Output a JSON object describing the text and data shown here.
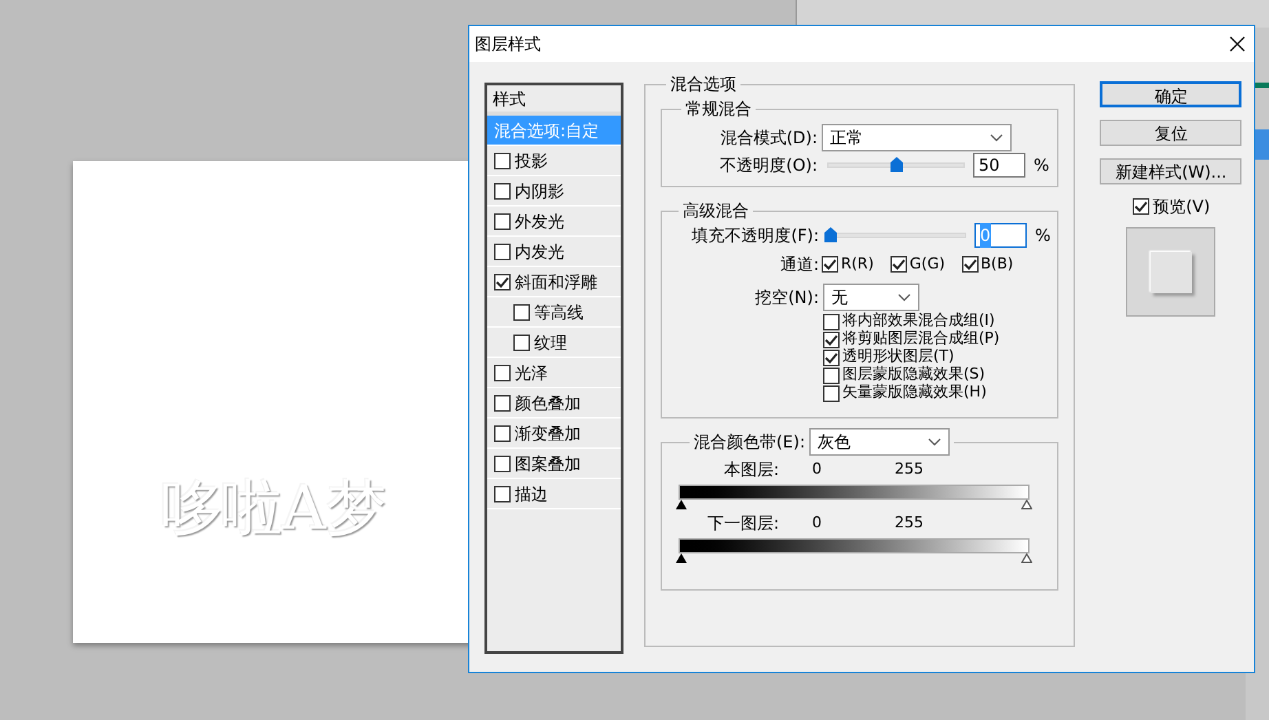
{
  "canvas": {
    "text": "哆啦A梦"
  },
  "window": {
    "title": "图层样式"
  },
  "styles": {
    "header": "样式",
    "items": [
      {
        "label": "混合选项:自定",
        "kind": "plain",
        "selected": true
      },
      {
        "label": "投影",
        "kind": "checkbox",
        "selected": false,
        "checked": false
      },
      {
        "label": "内阴影",
        "kind": "checkbox",
        "selected": false,
        "checked": false
      },
      {
        "label": "外发光",
        "kind": "checkbox",
        "selected": false,
        "checked": false
      },
      {
        "label": "内发光",
        "kind": "checkbox",
        "selected": false,
        "checked": false
      },
      {
        "label": "斜面和浮雕",
        "kind": "checkbox",
        "selected": false,
        "checked": true,
        "children": [
          {
            "label": "等高线",
            "kind": "checkbox",
            "selected": false,
            "checked": false
          },
          {
            "label": "纹理",
            "kind": "checkbox",
            "selected": false,
            "checked": false
          }
        ]
      },
      {
        "label": "光泽",
        "kind": "checkbox",
        "selected": false,
        "checked": false
      },
      {
        "label": "颜色叠加",
        "kind": "checkbox",
        "selected": false,
        "checked": false
      },
      {
        "label": "渐变叠加",
        "kind": "checkbox",
        "selected": false,
        "checked": false
      },
      {
        "label": "图案叠加",
        "kind": "checkbox",
        "selected": false,
        "checked": false
      },
      {
        "label": "描边",
        "kind": "checkbox",
        "selected": false,
        "checked": false
      }
    ]
  },
  "blending": {
    "title": "混合选项",
    "general": {
      "title": "常规混合",
      "mode_label": "混合模式(D):",
      "mode_value": "正常",
      "opacity_label": "不透明度(O):",
      "opacity": {
        "level": 0.5
      },
      "opacity_value": "50",
      "unit": "%"
    },
    "advanced": {
      "title": "高级混合",
      "fill_label": "填充不透明度(F):",
      "fill": {
        "level": 0
      },
      "fill_value": "0",
      "unit": "%",
      "channels_label": "通道:",
      "channels": [
        {
          "label": "R(R)",
          "checked": true
        },
        {
          "label": "G(G)",
          "checked": true
        },
        {
          "label": "B(B)",
          "checked": true
        }
      ],
      "knockout_label": "挖空(N):",
      "knockout_value": "无",
      "options": [
        {
          "label": "将内部效果混合成组(I)",
          "checked": false
        },
        {
          "label": "将剪贴图层混合成组(P)",
          "checked": true
        },
        {
          "label": "透明形状图层(T)",
          "checked": true
        },
        {
          "label": "图层蒙版隐藏效果(S)",
          "checked": false
        },
        {
          "label": "矢量蒙版隐藏效果(H)",
          "checked": false
        }
      ]
    },
    "blend_if": {
      "label": "混合颜色带(E):",
      "value": "灰色",
      "bands": [
        {
          "label": "本图层:",
          "low": "0",
          "high": "255"
        },
        {
          "label": "下一图层:",
          "low": "0",
          "high": "255"
        }
      ]
    }
  },
  "buttons": [
    {
      "label": "确定",
      "selected": true
    },
    {
      "label": "复位",
      "selected": false
    },
    {
      "label": "新建样式(W)...",
      "selected": false
    }
  ],
  "preview": {
    "label": "预览(V)",
    "checked": true
  }
}
